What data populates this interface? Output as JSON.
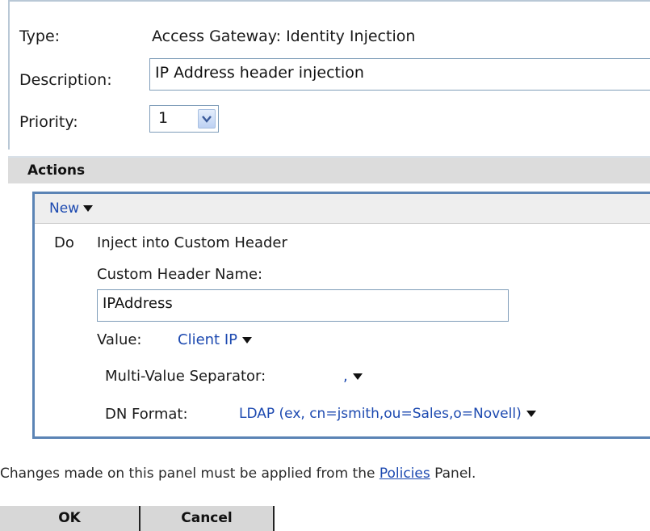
{
  "form": {
    "type_label": "Type:",
    "type_value": "Access Gateway: Identity Injection",
    "description_label": "Description:",
    "description_value": "IP Address header injection",
    "priority_label": "Priority:",
    "priority_value": "1"
  },
  "actions": {
    "section_title": "Actions",
    "new_menu": "New",
    "do_label": "Do",
    "action_title": "Inject into Custom Header",
    "custom_header_name_label": "Custom Header Name:",
    "custom_header_name_value": "IPAddress",
    "value_label": "Value:",
    "value_selection": "Client IP",
    "multi_value_separator_label": "Multi-Value Separator:",
    "multi_value_separator_selection": ",",
    "dn_format_label": "DN Format:",
    "dn_format_selection": "LDAP (ex, cn=jsmith,ou=Sales,o=Novell)"
  },
  "footer": {
    "note_prefix": "Changes made on this panel must be applied from the",
    "note_link": "Policies",
    "note_suffix": "Panel."
  },
  "buttons": {
    "ok": "OK",
    "cancel": "Cancel"
  },
  "colors": {
    "link": "#1c49b0",
    "actions_border": "#5b84b5",
    "section_bar": "#dcdcdc"
  }
}
